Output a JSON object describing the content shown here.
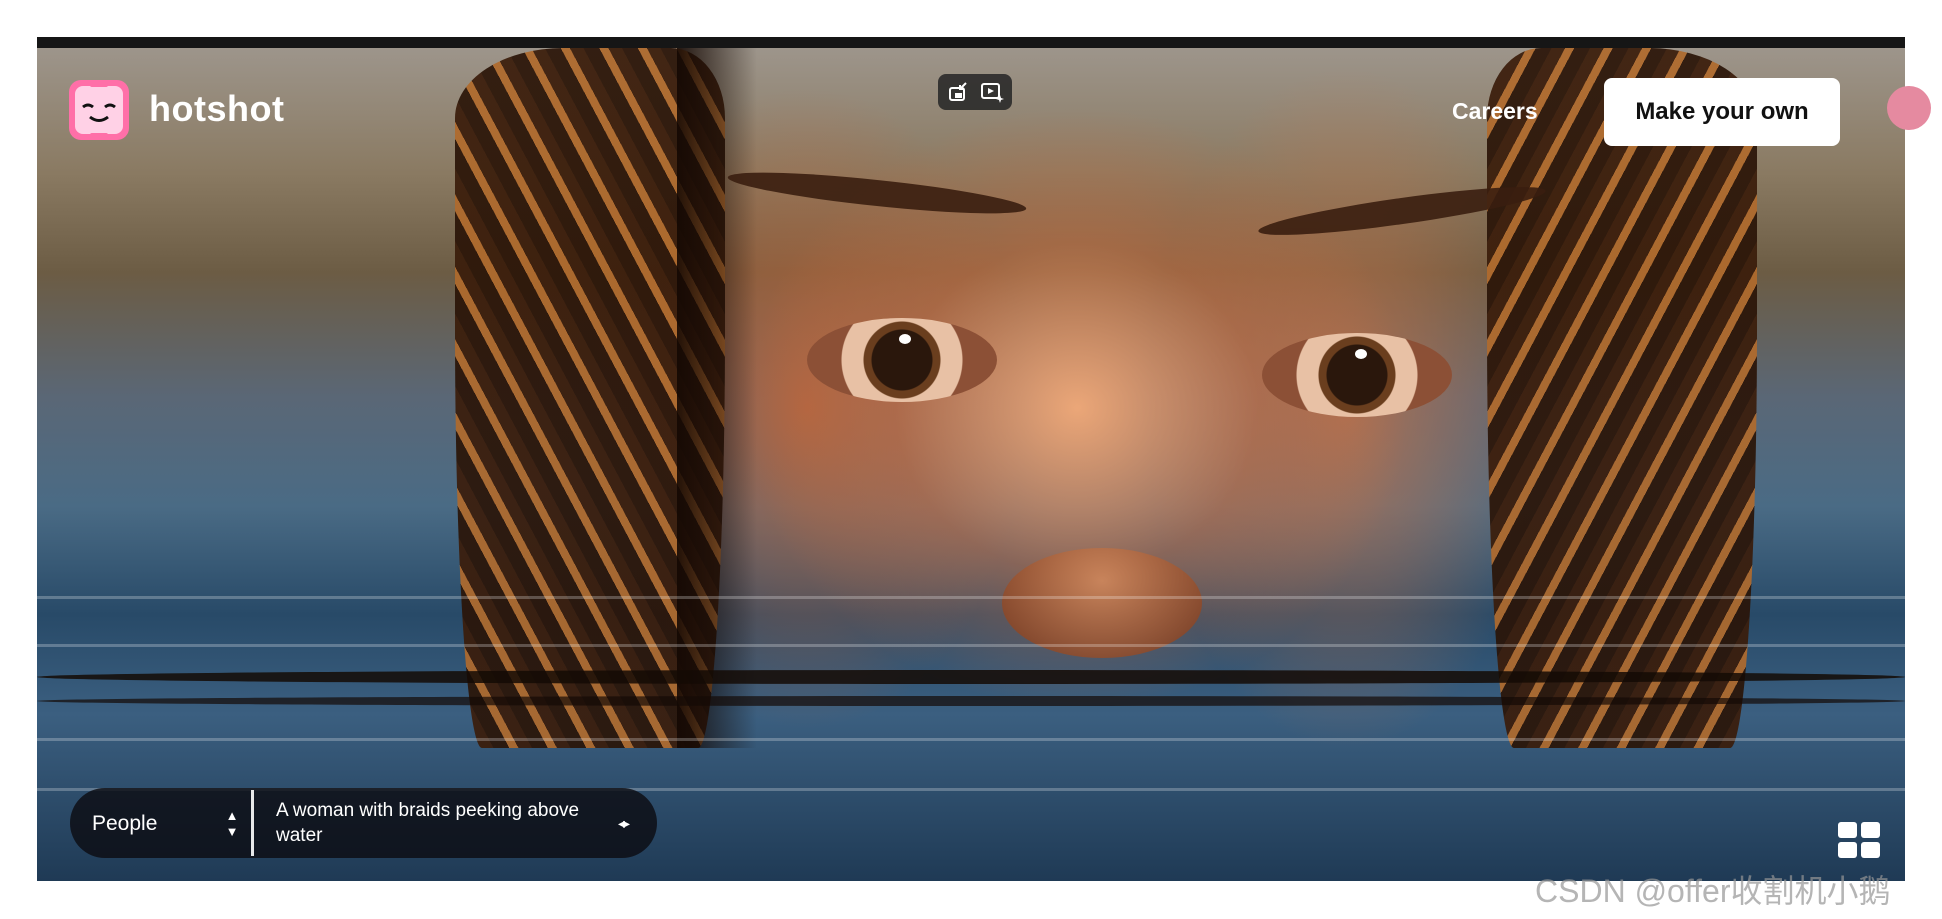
{
  "app": {
    "brand_name": "hotshot",
    "logo_icon": "smiling-face-logo-icon",
    "brand_pink": "#ff6fa8",
    "logo_face": "#ffd1e6"
  },
  "header": {
    "careers_label": "Careers",
    "cta_label": "Make your own",
    "video_controls": [
      "exit-pip-icon",
      "play-sparkle-icon"
    ]
  },
  "hero": {
    "subject": "woman with braids peeking above water"
  },
  "footer_controls": {
    "category_value": "People",
    "stepper_up": "▲",
    "stepper_down": "▼",
    "prompt_text": "A woman with braids peeking above water",
    "prev_next_glyph": "◂▸",
    "grid_icon": "grid-view-icon"
  },
  "watermark": {
    "text": "CSDN @offer收割机小鹅"
  }
}
